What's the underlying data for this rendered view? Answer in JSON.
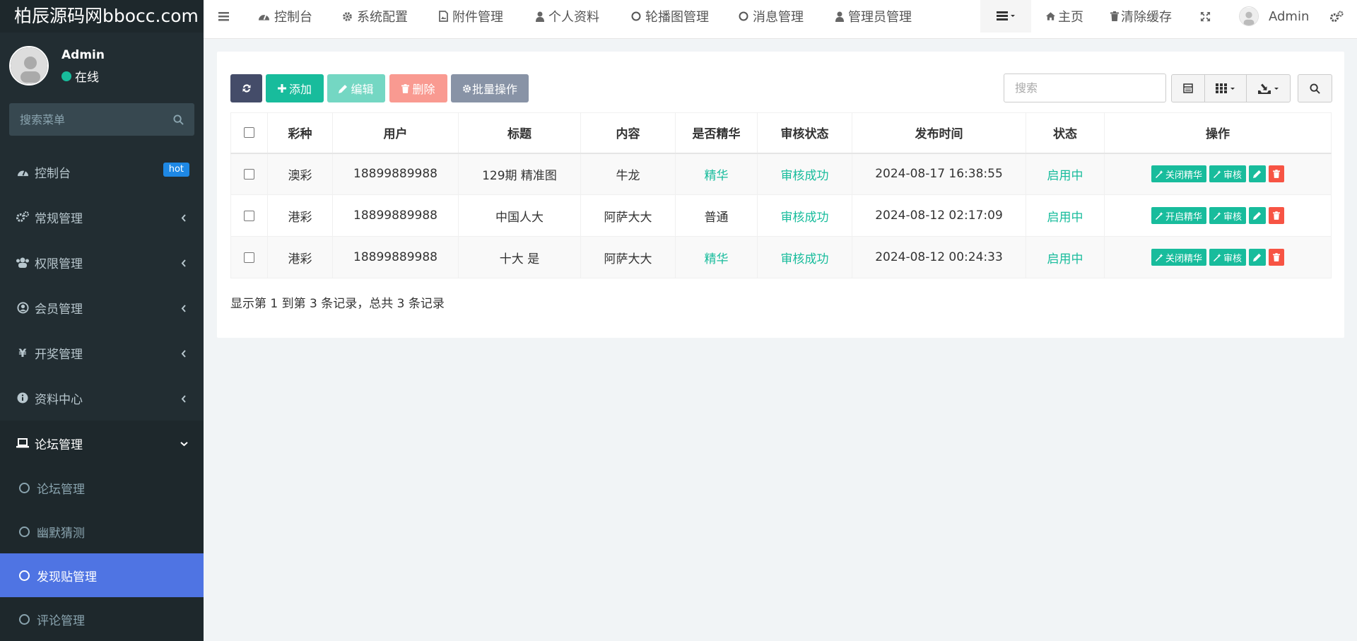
{
  "sidebar": {
    "logo": "柏辰源码网bbocc.com",
    "user": {
      "name": "Admin",
      "status": "在线"
    },
    "search_placeholder": "搜索菜单",
    "menu": [
      {
        "label": "控制台",
        "icon": "dashboard-icon",
        "badge": "hot"
      },
      {
        "label": "常规管理",
        "icon": "cogs-icon"
      },
      {
        "label": "权限管理",
        "icon": "group-icon"
      },
      {
        "label": "会员管理",
        "icon": "user-circle-icon"
      },
      {
        "label": "开奖管理",
        "icon": "yen-icon"
      },
      {
        "label": "资料中心",
        "icon": "info-icon"
      },
      {
        "label": "论坛管理",
        "icon": "laptop-icon"
      }
    ],
    "submenu": [
      {
        "label": "论坛管理"
      },
      {
        "label": "幽默猜测"
      },
      {
        "label": "发现贴管理"
      },
      {
        "label": "评论管理"
      }
    ]
  },
  "topnav": {
    "tabs": [
      {
        "label": "控制台",
        "icon": "dashboard-icon"
      },
      {
        "label": "系统配置",
        "icon": "gear-icon"
      },
      {
        "label": "附件管理",
        "icon": "file-image-icon"
      },
      {
        "label": "个人资料",
        "icon": "user-icon"
      },
      {
        "label": "轮播图管理",
        "icon": "circle-icon"
      },
      {
        "label": "消息管理",
        "icon": "circle-icon"
      },
      {
        "label": "管理员管理",
        "icon": "user-icon"
      }
    ],
    "home": "主页",
    "clear_cache": "清除缓存",
    "admin": "Admin"
  },
  "toolbar": {
    "add": "添加",
    "edit": "编辑",
    "delete": "删除",
    "batch": "批量操作",
    "search_placeholder": "搜索"
  },
  "table": {
    "headers": [
      "彩种",
      "用户",
      "标题",
      "内容",
      "是否精华",
      "审核状态",
      "发布时间",
      "状态",
      "操作"
    ],
    "rows": [
      {
        "lottery": "澳彩",
        "user": "18899889988",
        "title": "129期 精准图",
        "content": "牛龙",
        "essence": "精华",
        "audit": "审核成功",
        "time": "2024-08-17 16:38:55",
        "status": "启用中",
        "toggle": "关闭精华",
        "review": "审核"
      },
      {
        "lottery": "港彩",
        "user": "18899889988",
        "title": "中国人大",
        "content": "阿萨大大",
        "essence": "普通",
        "audit": "审核成功",
        "time": "2024-08-12 02:17:09",
        "status": "启用中",
        "toggle": "开启精华",
        "review": "审核"
      },
      {
        "lottery": "港彩",
        "user": "18899889988",
        "title": "十大 是",
        "content": "阿萨大大",
        "essence": "精华",
        "audit": "审核成功",
        "time": "2024-08-12 00:24:33",
        "status": "启用中",
        "toggle": "关闭精华",
        "review": "审核"
      }
    ],
    "summary": "显示第 1 到第 3 条记录，总共 3 条记录"
  },
  "colors": {
    "sidebar_bg": "#222d32",
    "primary": "#18bc9c",
    "danger": "#f75444",
    "active_menu": "#4f74e3",
    "refresh_btn": "#444c69",
    "batch_btn": "#8893a6"
  }
}
